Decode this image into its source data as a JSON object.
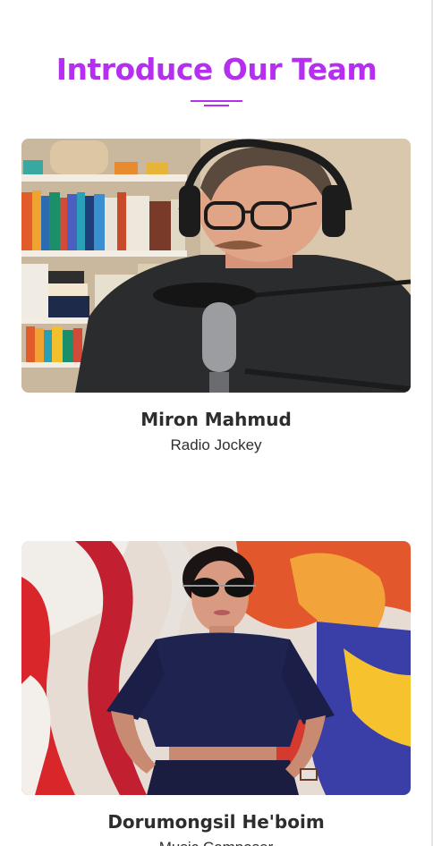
{
  "section": {
    "title": "Introduce Our Team"
  },
  "team": [
    {
      "name": "Miron Mahmud",
      "role": "Radio Jockey"
    },
    {
      "name": "Dorumongsil He'boim",
      "role": "Music Composer"
    }
  ],
  "colors": {
    "accent": "#b52ff0",
    "text_dark": "#2d2d2d",
    "background": "#ffffff"
  }
}
